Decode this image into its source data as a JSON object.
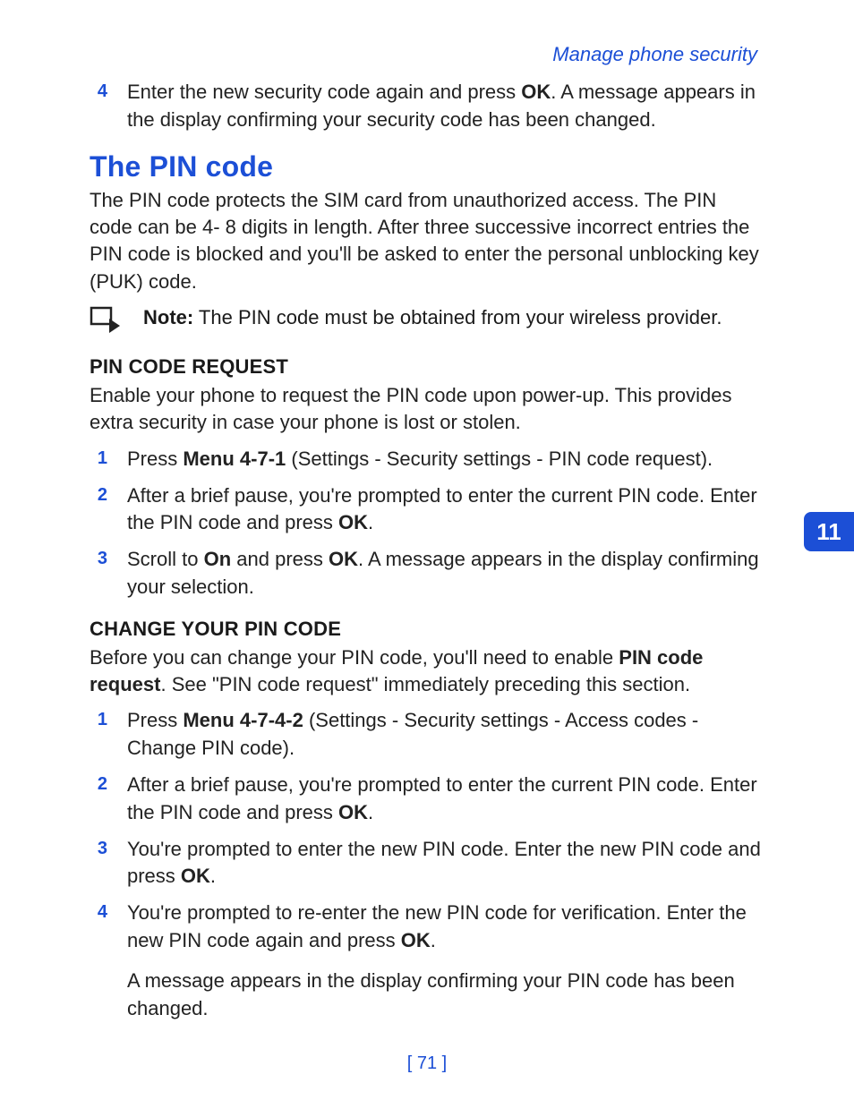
{
  "breadcrumb": "Manage phone security",
  "chapter": "11",
  "page_number": "[ 71 ]",
  "openingStep": {
    "num": "4",
    "pre": "Enter the new security code again and press ",
    "bold": "OK",
    "post": ". A message appears in the display confirming your security code has been changed."
  },
  "h1": "The PIN code",
  "intro": "The PIN code protects the SIM card from unauthorized access. The PIN code can be 4- 8 digits in length. After three successive incorrect entries the PIN code is blocked and you'll be asked to enter the personal unblocking key (PUK) code.",
  "note": {
    "label": "Note:",
    "text": " The PIN code must be obtained from your wireless provider."
  },
  "sec1": {
    "title": "PIN CODE REQUEST",
    "intro": "Enable your phone to request the PIN code upon power-up. This provides extra security in case your phone is lost or stolen.",
    "s1": {
      "num": "1",
      "pre": "Press ",
      "b1": "Menu 4-7-1",
      "post": " (Settings - Security settings - PIN code request)."
    },
    "s2": {
      "num": "2",
      "pre": "After a brief pause, you're prompted to enter the current PIN code. Enter the PIN code and press ",
      "b1": "OK",
      "post": "."
    },
    "s3": {
      "num": "3",
      "pre": "Scroll to ",
      "b1": "On",
      "mid": " and press ",
      "b2": "OK",
      "post": ". A message appears in the display confirming your selection."
    }
  },
  "sec2": {
    "title": "CHANGE YOUR PIN CODE",
    "intro": {
      "pre": "Before you can change your PIN code, you'll need to enable ",
      "b1": "PIN code request",
      "post": ". See \"PIN code request\" immediately preceding this section."
    },
    "s1": {
      "num": "1",
      "pre": "Press ",
      "b1": "Menu 4-7-4-2",
      "post": " (Settings - Security settings - Access codes - Change PIN code)."
    },
    "s2": {
      "num": "2",
      "pre": "After a brief pause, you're prompted to enter the current PIN code. Enter the PIN code and press ",
      "b1": "OK",
      "post": "."
    },
    "s3": {
      "num": "3",
      "pre": "You're prompted to enter the new PIN code. Enter the new PIN code and press ",
      "b1": "OK",
      "post": "."
    },
    "s4": {
      "num": "4",
      "pre": "You're prompted to re-enter the new PIN code for verification. Enter the new PIN code again and press ",
      "b1": "OK",
      "post": "."
    },
    "tail": "A message appears in the display confirming your PIN code has been changed."
  }
}
